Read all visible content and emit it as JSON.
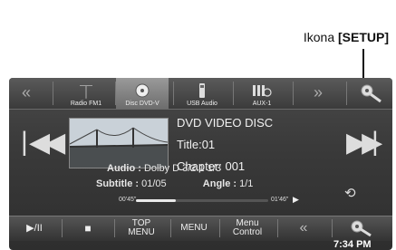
{
  "callout": {
    "prefix": "Ikona ",
    "label": "[SETUP]"
  },
  "source_bar": {
    "items": [
      {
        "label": "Radio FM1",
        "icon": "antenna-icon"
      },
      {
        "label": "Disc DVD-V",
        "icon": "disc-icon",
        "active": true
      },
      {
        "label": "USB Audio",
        "icon": "usb-icon"
      },
      {
        "label": "AUX-1",
        "icon": "aux-icon"
      }
    ],
    "prev_arrow": "«",
    "next_arrow": "»"
  },
  "player": {
    "disc_type": "DVD VIDEO DISC",
    "title": "Title:01",
    "chapter": "Chapter: 001",
    "audio_label": "Audio :",
    "audio_value": "Dolby  D   3/2.1   1/3",
    "subtitle_label": "Subtitle :",
    "subtitle_value": "01/05",
    "angle_label": "Angle :",
    "angle_value": "1/1",
    "elapsed": "00'45\"",
    "remaining": "01'46\"",
    "progress_fraction": 0.3
  },
  "bottom_bar": {
    "play_pause": "▶/II",
    "stop": "■",
    "top_menu": "TOP\nMENU",
    "menu": "MENU",
    "menu_control": "Menu\nControl",
    "back_arrow": "«"
  },
  "clock": "7:34 PM"
}
